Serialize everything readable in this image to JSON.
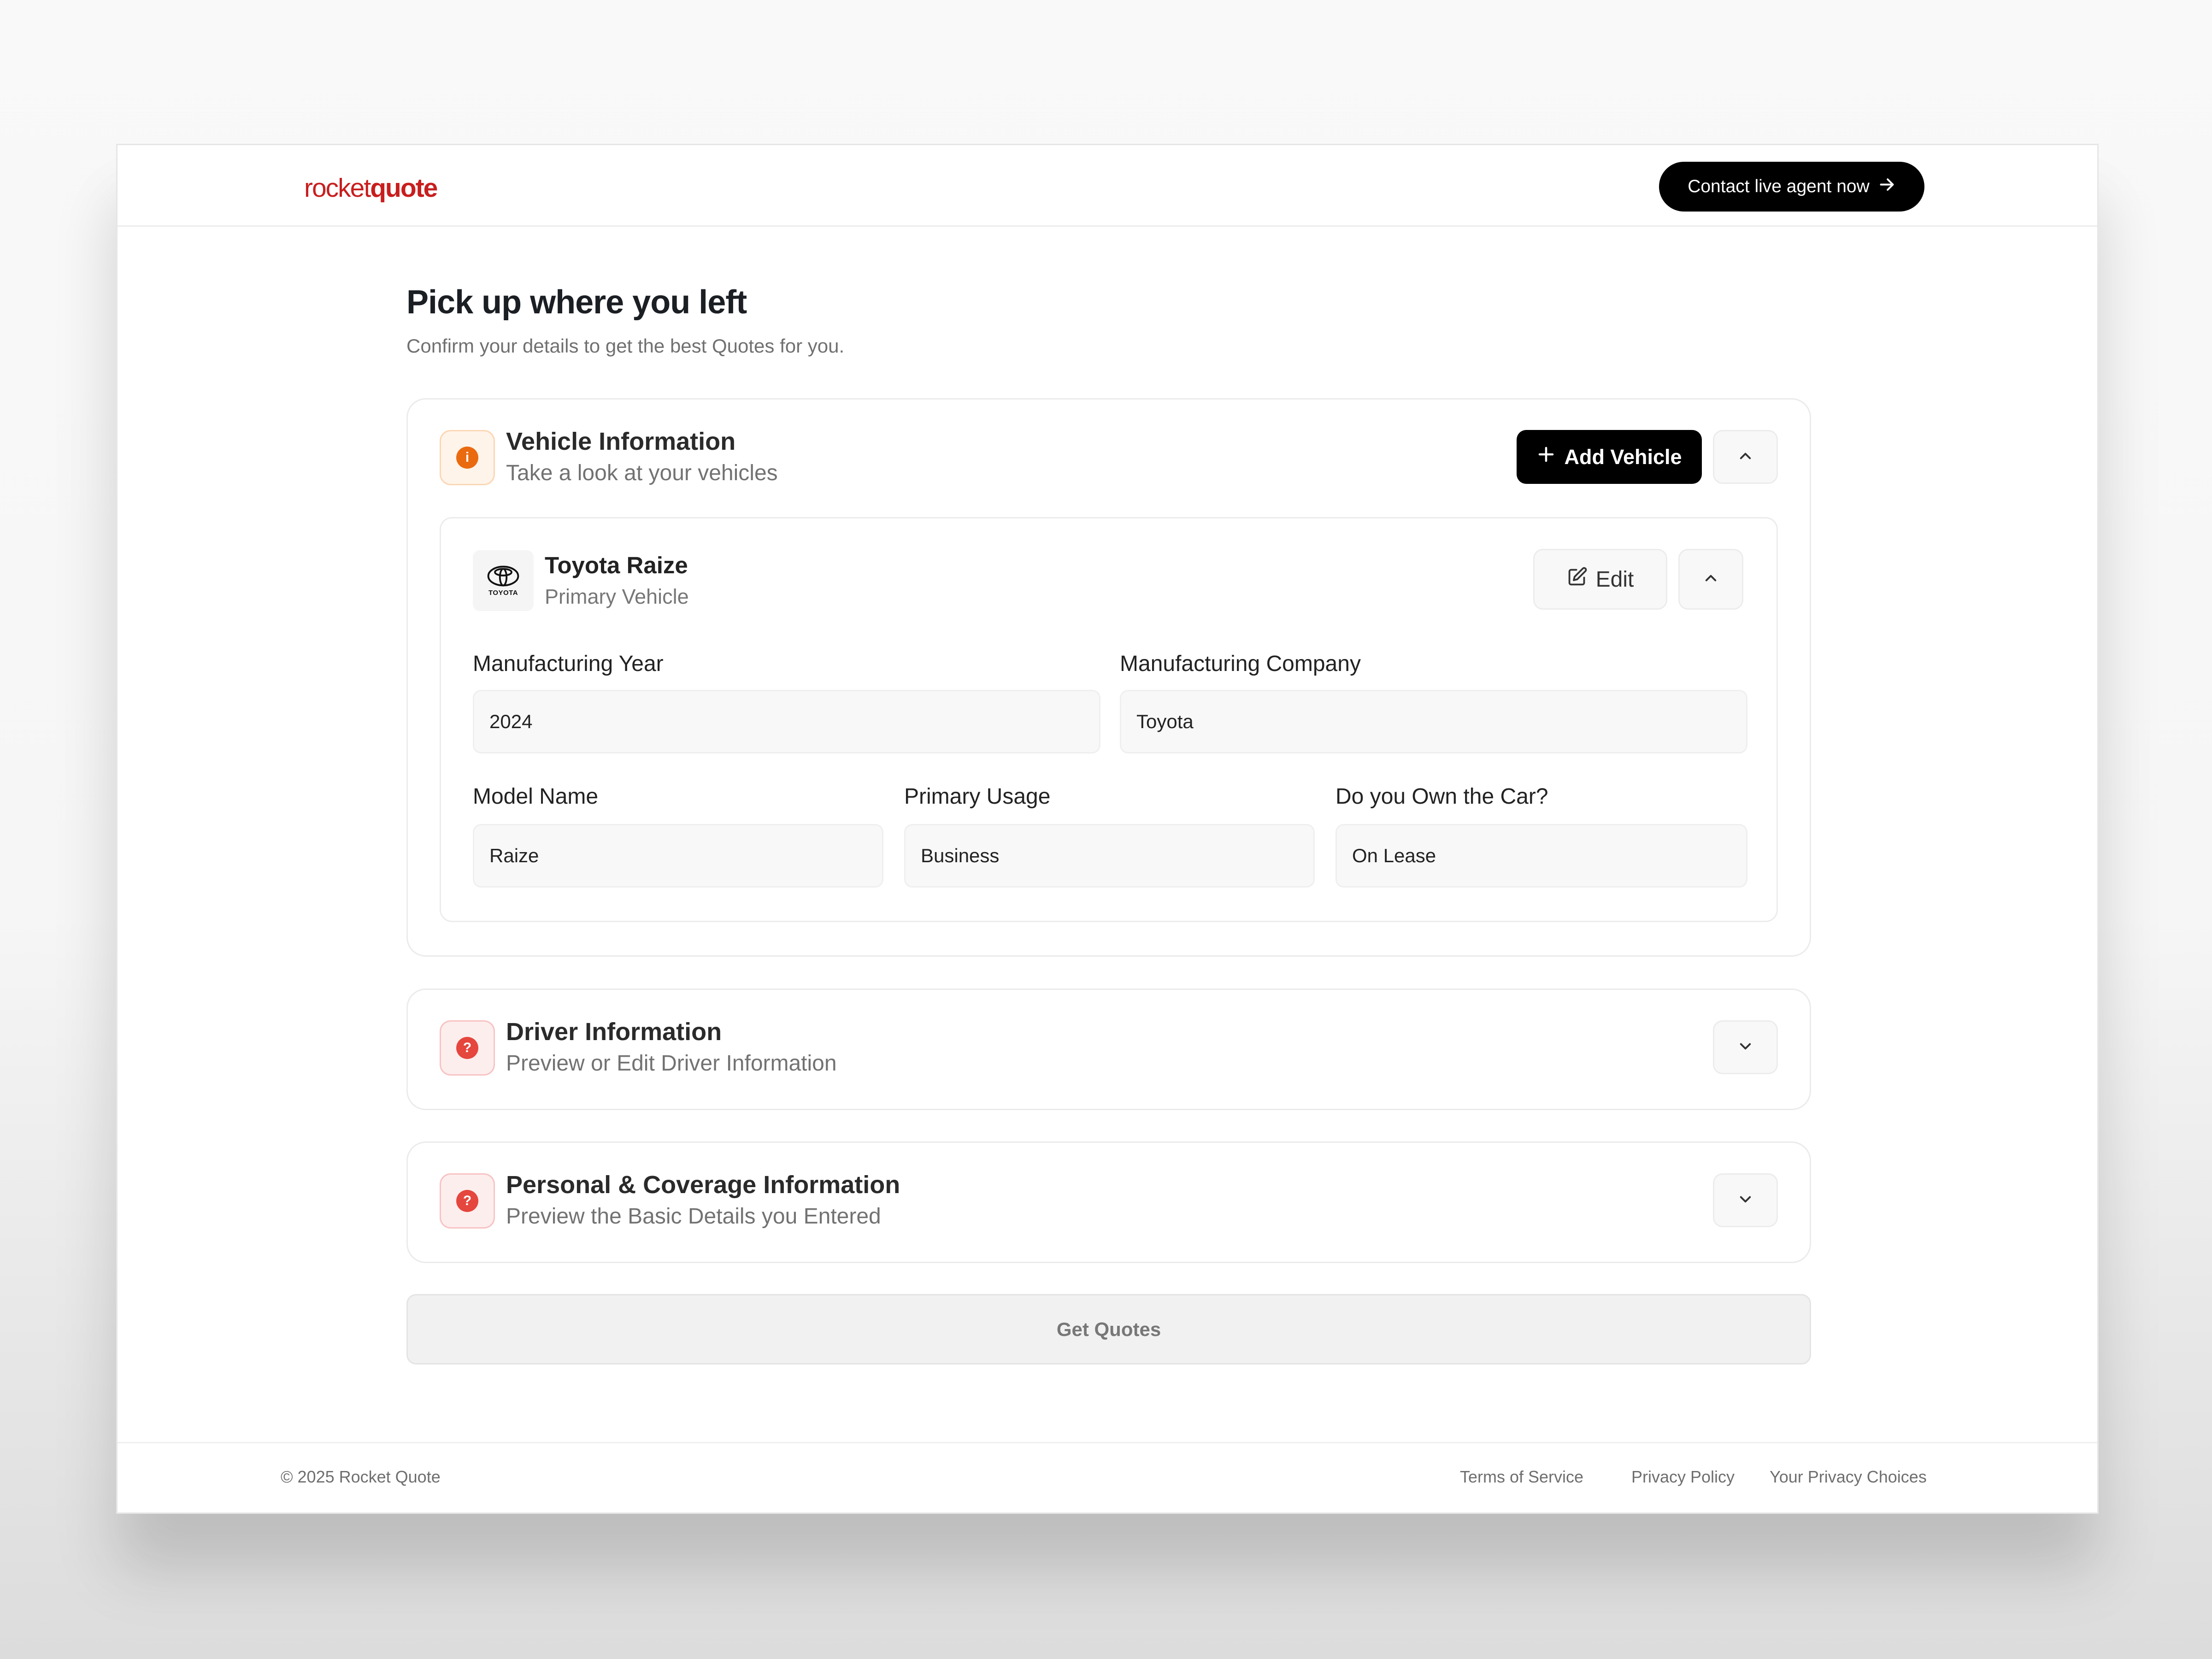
{
  "header": {
    "logo_regular": "rocket",
    "logo_bold": "quote",
    "contact_button": "Contact live agent now"
  },
  "page": {
    "title": "Pick up where you left",
    "subtitle": "Confirm your details to get the best Quotes for you."
  },
  "vehicle_section": {
    "title": "Vehicle Information",
    "subtitle": "Take a look at your vehicles",
    "status_symbol": "i",
    "add_button": "Add Vehicle",
    "vehicle": {
      "brand_logo_text": "TOYOTA",
      "name": "Toyota Raize",
      "role": "Primary Vehicle",
      "edit_button": "Edit",
      "fields": {
        "manufacturing_year": {
          "label": "Manufacturing Year",
          "value": "2024"
        },
        "manufacturing_company": {
          "label": "Manufacturing Company",
          "value": "Toyota"
        },
        "model_name": {
          "label": "Model Name",
          "value": "Raize"
        },
        "primary_usage": {
          "label": "Primary Usage",
          "value": "Business"
        },
        "own_car": {
          "label": "Do you Own the Car?",
          "value": "On Lease"
        }
      }
    }
  },
  "driver_section": {
    "title": "Driver Information",
    "subtitle": "Preview or Edit Driver Information",
    "status_symbol": "?"
  },
  "personal_section": {
    "title": "Personal & Coverage Information",
    "subtitle": "Preview the Basic Details you Entered",
    "status_symbol": "?"
  },
  "get_quotes_button": "Get Quotes",
  "footer": {
    "copyright": "© 2025 Rocket Quote",
    "links": [
      "Terms of Service",
      "Privacy Policy",
      "Your Privacy Choices"
    ]
  },
  "colors": {
    "brand": "#c81e1e",
    "info_status": "#ea6a0f",
    "warning_status": "#e5463d",
    "primary_button": "#000000"
  },
  "icons": {
    "contact_arrow": "arrow-right-icon",
    "add": "plus-icon",
    "collapse": "chevron-up-icon",
    "expand": "chevron-down-icon",
    "edit": "edit-icon",
    "brand": "toyota-logo-icon"
  }
}
